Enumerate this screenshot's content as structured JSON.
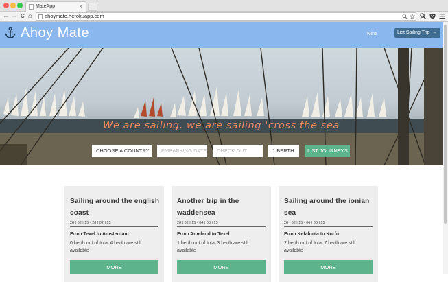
{
  "browser": {
    "tab_title": "MateApp",
    "tab_close": "×",
    "url": "ahoymate.herokuapp.com",
    "back_icon": "←",
    "forward_icon": "→",
    "reload_icon": "C",
    "home_icon": "⌂"
  },
  "header": {
    "brand": "Ahoy Mate",
    "user": "Nina",
    "list_trip_label": "List Sailing Trip",
    "list_trip_arrow": "→",
    "bg_color": "#8ab7ee"
  },
  "hero": {
    "caption": "We are sailing, we are sailing 'cross the sea",
    "country_select": "CHOOSE A COUNTRY",
    "embark_placeholder": "EMBARKING DATE",
    "checkout_placeholder": "CHECK OUT",
    "berth_select": "1 BERTH",
    "list_journeys_label": "LIST JOURNEYS",
    "caption_color": "#f28a5e"
  },
  "trips": [
    {
      "title": "Sailing around the english coast",
      "dates": "26 | 02 | 15 - 28 | 02 | 15",
      "route": "From Texel to Amsterdam",
      "berths": "0 berth out of total 4 berth are still available",
      "more": "MORE"
    },
    {
      "title": "Another trip in the waddensea",
      "dates": "28 | 02 | 15 - 04 | 03 | 15",
      "route": "From Ameland to Texel",
      "berths": "1 berth out of total 3 berth are still available",
      "more": "MORE"
    },
    {
      "title": "Sailing around the ionian sea",
      "dates": "26 | 02 | 15 - 06 | 03 | 15",
      "route": "From Kefalonia to Korfu",
      "berths": "2 berth out of total 7 berth are still available",
      "more": "MORE"
    }
  ],
  "accent_color": "#5db38c"
}
